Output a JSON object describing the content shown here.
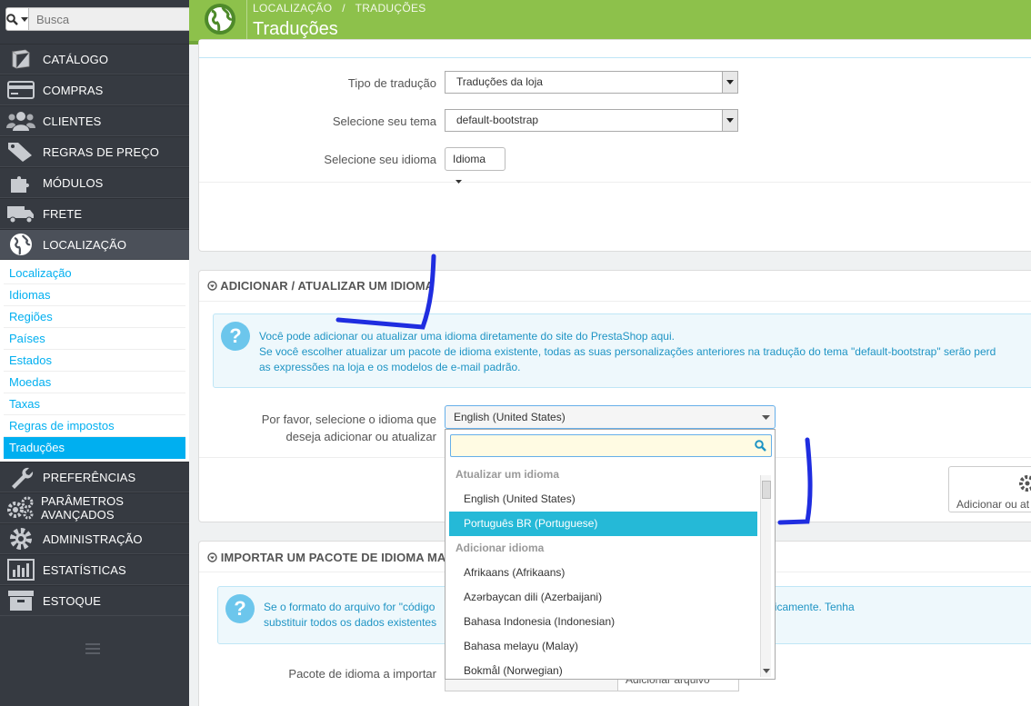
{
  "search": {
    "placeholder": "Busca"
  },
  "sidebar": {
    "items": [
      {
        "label": "CATÁLOGO",
        "icon": "book-icon"
      },
      {
        "label": "COMPRAS",
        "icon": "credit-card-icon"
      },
      {
        "label": "CLIENTES",
        "icon": "users-icon"
      },
      {
        "label": "REGRAS DE PREÇO",
        "icon": "tags-icon"
      },
      {
        "label": "MÓDULOS",
        "icon": "puzzle-icon"
      },
      {
        "label": "FRETE",
        "icon": "truck-icon"
      },
      {
        "label": "LOCALIZAÇÃO",
        "icon": "globe-icon"
      }
    ],
    "submenu": [
      "Localização",
      "Idiomas",
      "Regiões",
      "Países",
      "Estados",
      "Moedas",
      "Taxas",
      "Regras de impostos",
      "Traduções"
    ],
    "items_after": [
      {
        "label": "PREFERÊNCIAS",
        "icon": "wrench-icon"
      },
      {
        "label": "PARÂMETROS AVANÇADOS",
        "icon": "cogs-icon"
      },
      {
        "label": "ADMINISTRAÇÃO",
        "icon": "gear-icon"
      },
      {
        "label": "ESTATÍSTICAS",
        "icon": "bar-chart-icon"
      },
      {
        "label": "ESTOQUE",
        "icon": "archive-icon"
      }
    ]
  },
  "header": {
    "breadcrumb_1": "LOCALIZAÇÃO",
    "breadcrumb_sep": "/",
    "breadcrumb_2": "TRADUÇÕES",
    "title": "Traduções"
  },
  "form1": {
    "type_label": "Tipo de tradução",
    "type_value": "Traduções da loja",
    "theme_label": "Selecione seu tema",
    "theme_value": "default-bootstrap",
    "lang_label": "Selecione seu idioma",
    "lang_button": "Idioma"
  },
  "panel2": {
    "heading": "ADICIONAR / ATUALIZAR UM IDIOMA",
    "info_line1": "Você pode adicionar ou atualizar uma idioma diretamente do site do PrestaShop aqui.",
    "info_line2": "Se você escolher atualizar um pacote de idioma existente, todas as suas personalizações anteriores na tradução do tema \"default-bootstrap\" serão perd",
    "info_line3": "as expressões na loja e os modelos de e-mail padrão.",
    "select_label_1": "Por favor, selecione o idioma que",
    "select_label_2": "deseja adicionar ou atualizar",
    "select_value": "English (United States)",
    "button_label": "Adicionar ou at"
  },
  "dropdown": {
    "group1": "Atualizar um idioma",
    "group1_options": [
      "English (United States)",
      "Português BR (Portuguese)"
    ],
    "group2": "Adicionar idioma",
    "group2_options": [
      "Afrikaans (Afrikaans)",
      "Azərbaycan dili (Azerbaijani)",
      "Bahasa Indonesia (Indonesian)",
      "Bahasa melayu (Malay)",
      "Bokmål (Norwegian)"
    ]
  },
  "panel3": {
    "heading": "IMPORTAR UM PACOTE DE IDIOMA MANUALM",
    "info_line1_a": "Se o formato do arquivo for \"código",
    "info_line1_b": "ão existir, ele será criado automaticamente. Tenha",
    "info_line2": "substituir todos os dados existentes",
    "import_label": "Pacote de idioma a importar",
    "file_button": "Adicionar arquivo"
  },
  "colors": {
    "header": "#8dc14b",
    "sidebar": "#363a41",
    "accent": "#00aff0",
    "annotation": "#1f2de0"
  }
}
